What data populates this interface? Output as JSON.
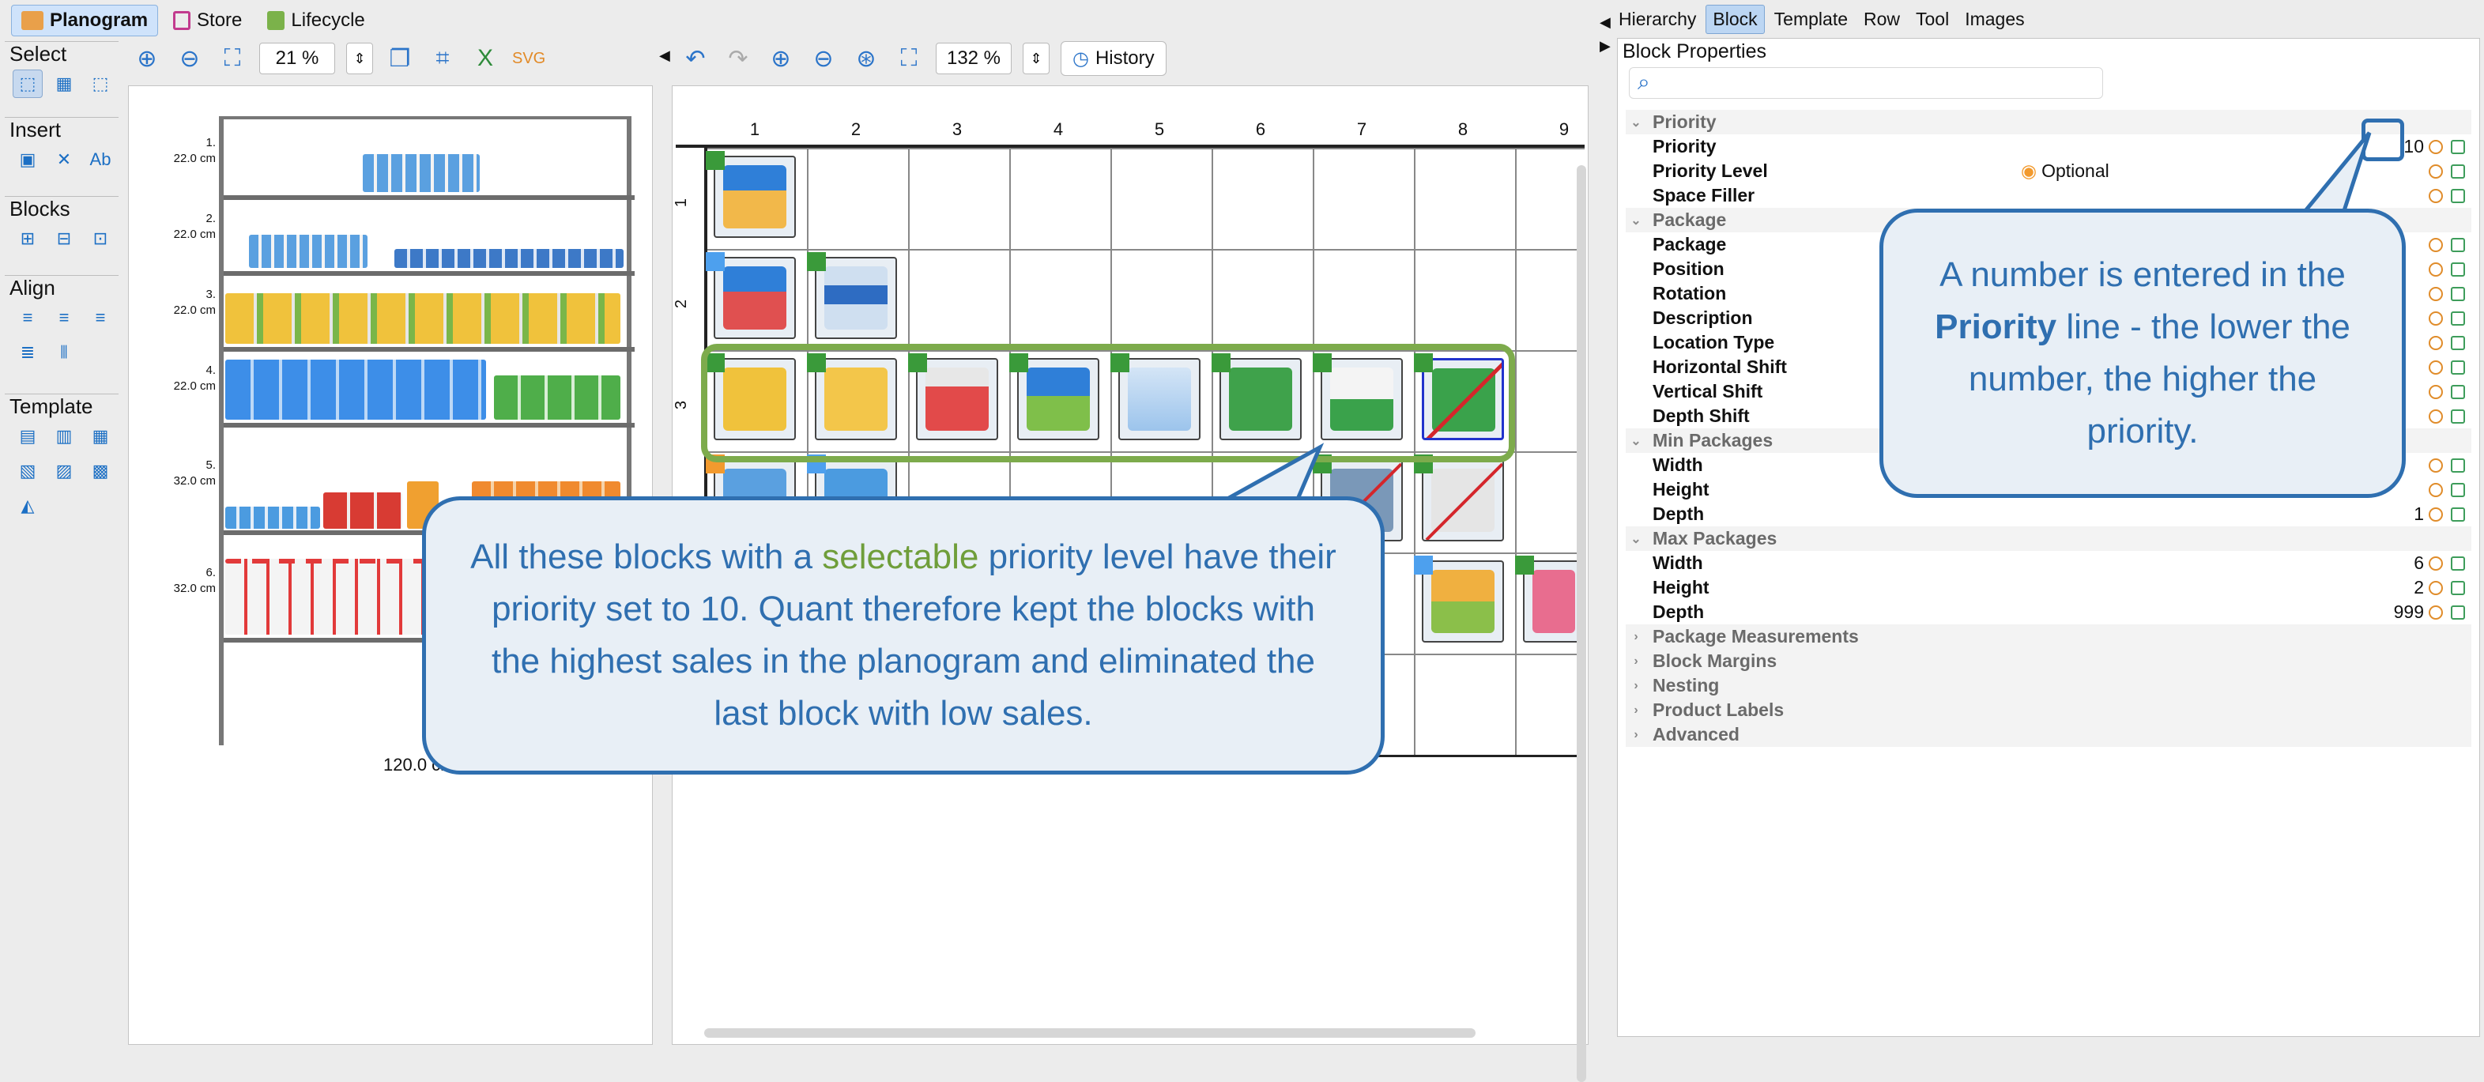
{
  "top_tabs": [
    "Planogram",
    "Store",
    "Lifecycle"
  ],
  "palette": {
    "select": "Select",
    "insert": "Insert",
    "blocks": "Blocks",
    "align": "Align",
    "template": "Template"
  },
  "shelf_toolbar": {
    "zoom": "21 %"
  },
  "grid_toolbar": {
    "zoom": "132 %",
    "history": "History"
  },
  "shelf_view": {
    "shelves": [
      {
        "num": "1.",
        "height": "22.0 cm"
      },
      {
        "num": "2.",
        "height": "22.0 cm"
      },
      {
        "num": "3.",
        "height": "22.0 cm"
      },
      {
        "num": "4.",
        "height": "22.0 cm"
      },
      {
        "num": "5.",
        "height": "32.0 cm"
      },
      {
        "num": "6.",
        "height": "32.0 cm"
      }
    ],
    "width_label": "120.0 cm"
  },
  "grid": {
    "columns": [
      "1",
      "2",
      "3",
      "4",
      "5",
      "6",
      "7",
      "8",
      "9"
    ],
    "rows": [
      "1",
      "2",
      "3"
    ]
  },
  "right_tabs": [
    "Hierarchy",
    "Block",
    "Template",
    "Row",
    "Tool",
    "Images"
  ],
  "props": {
    "title": "Block Properties",
    "rows": [
      {
        "type": "section",
        "name": "Priority"
      },
      {
        "type": "item",
        "name": "Priority",
        "value": "10"
      },
      {
        "type": "item",
        "name": "Priority Level",
        "value_left": "Optional"
      },
      {
        "type": "item",
        "name": "Space Filler",
        "value": ""
      },
      {
        "type": "section",
        "name": "Package"
      },
      {
        "type": "item",
        "name": "Package",
        "value": ""
      },
      {
        "type": "item",
        "name": "Position",
        "value": ""
      },
      {
        "type": "item",
        "name": "Rotation",
        "value": ""
      },
      {
        "type": "item",
        "name": "Description",
        "value": ""
      },
      {
        "type": "item",
        "name": "Location Type",
        "value": ""
      },
      {
        "type": "item",
        "name": "Horizontal Shift",
        "value": ""
      },
      {
        "type": "item",
        "name": "Vertical Shift",
        "value": ""
      },
      {
        "type": "item",
        "name": "Depth Shift",
        "value": ""
      },
      {
        "type": "section",
        "name": "Min Packages"
      },
      {
        "type": "item",
        "name": "Width",
        "value": ""
      },
      {
        "type": "item",
        "name": "Height",
        "value": ""
      },
      {
        "type": "item",
        "name": "Depth",
        "value": "1"
      },
      {
        "type": "section",
        "name": "Max Packages"
      },
      {
        "type": "item",
        "name": "Width",
        "value": "6"
      },
      {
        "type": "item",
        "name": "Height",
        "value": "2"
      },
      {
        "type": "item",
        "name": "Depth",
        "value": "999"
      },
      {
        "type": "collapsed",
        "name": "Package Measurements"
      },
      {
        "type": "collapsed",
        "name": "Block Margins"
      },
      {
        "type": "collapsed",
        "name": "Nesting"
      },
      {
        "type": "collapsed",
        "name": "Product Labels"
      },
      {
        "type": "collapsed",
        "name": "Advanced"
      }
    ]
  },
  "callouts": {
    "left_pre": "All these blocks with a ",
    "left_highlight": "selectable",
    "left_post": " priority level have their priority set to 10. Quant therefore kept the blocks with the highest sales in the planogram and eliminated the last block with low sales.",
    "right_pre": "A number is entered in the ",
    "right_bold": "Priority",
    "right_post": " line - the lower the number, the higher the priority."
  },
  "colors": {
    "accent": "#2f6fb0",
    "highlight_green": "#7dab4c",
    "selectable_text": "#6f9e3a"
  }
}
